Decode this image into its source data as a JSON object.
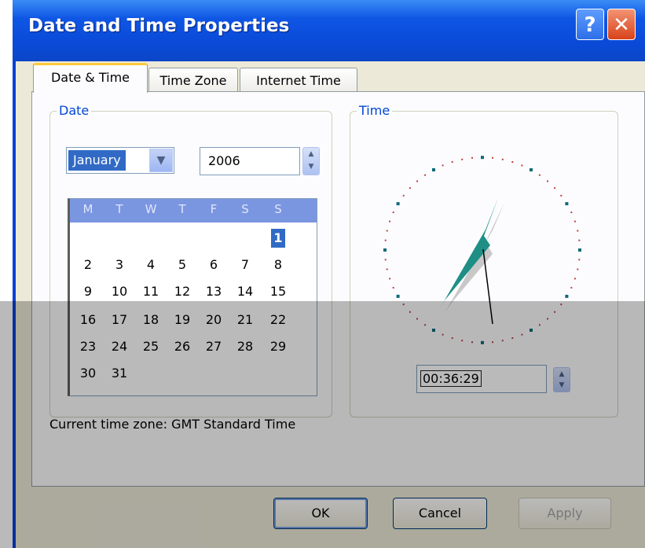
{
  "window": {
    "title": "Date and Time Properties",
    "help_glyph": "?",
    "close_glyph": "✕"
  },
  "tabs": [
    {
      "label": "Date & Time",
      "active": true
    },
    {
      "label": "Time Zone",
      "active": false
    },
    {
      "label": "Internet Time",
      "active": false
    }
  ],
  "date_group": {
    "label": "Date",
    "month": "January",
    "year": "2006",
    "day_names": [
      "M",
      "T",
      "W",
      "T",
      "F",
      "S",
      "S"
    ],
    "selected_day": "1",
    "weeks": [
      [
        "",
        "",
        "",
        "",
        "",
        "",
        "1"
      ],
      [
        "2",
        "3",
        "4",
        "5",
        "6",
        "7",
        "8"
      ],
      [
        "9",
        "10",
        "11",
        "12",
        "13",
        "14",
        "15"
      ],
      [
        "16",
        "17",
        "18",
        "19",
        "20",
        "21",
        "22"
      ],
      [
        "23",
        "24",
        "25",
        "26",
        "27",
        "28",
        "29"
      ],
      [
        "30",
        "31",
        "",
        "",
        "",
        "",
        ""
      ]
    ]
  },
  "time_group": {
    "label": "Time",
    "time": "00:36:29"
  },
  "timezone": {
    "label": "Current time zone:",
    "value": "GMT Standard Time"
  },
  "buttons": {
    "ok": "OK",
    "cancel": "Cancel",
    "apply": "Apply"
  },
  "colors": {
    "accent": "#0a3fd6",
    "clock_hands": "#1f8f86",
    "selection": "#316ac5"
  },
  "icons": {
    "dropdown": "chevron-down-icon",
    "spin": "spin-arrows-icon",
    "help": "help-icon",
    "close": "close-icon"
  }
}
